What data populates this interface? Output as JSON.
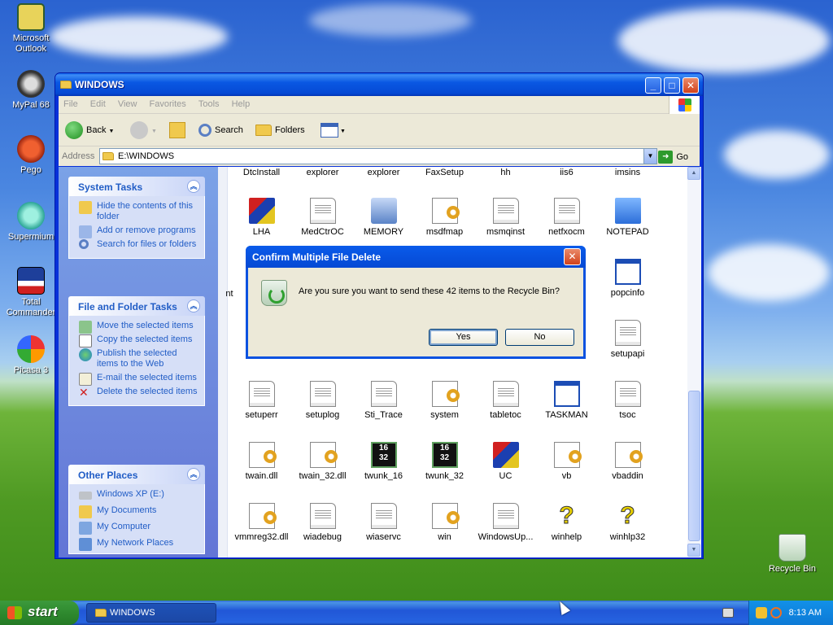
{
  "desktop": {
    "icons": [
      {
        "label": "Microsoft Outlook",
        "icon": "outlook-icon"
      },
      {
        "label": "MyPal 68",
        "icon": "mypal-icon"
      },
      {
        "label": "Pego",
        "icon": "pego-icon"
      },
      {
        "label": "Supermium",
        "icon": "supermium-icon"
      },
      {
        "label": "Total Commander",
        "icon": "total-commander-icon"
      },
      {
        "label": "Picasa 3",
        "icon": "picasa-icon"
      },
      {
        "label": "Recycle Bin",
        "icon": "recycle-bin-icon"
      }
    ]
  },
  "window": {
    "title": "WINDOWS",
    "menu": [
      "File",
      "Edit",
      "View",
      "Favorites",
      "Tools",
      "Help"
    ],
    "toolbar": {
      "back": "Back",
      "search": "Search",
      "folders": "Folders"
    },
    "address": {
      "label": "Address",
      "value": "E:\\WINDOWS",
      "go": "Go"
    }
  },
  "taskpane": {
    "system_tasks": {
      "title": "System Tasks",
      "items": [
        "Hide the contents of this folder",
        "Add or remove programs",
        "Search for files or folders"
      ]
    },
    "file_tasks": {
      "title": "File and Folder Tasks",
      "items": [
        "Move the selected items",
        "Copy the selected items",
        "Publish the selected items to the Web",
        "E-mail the selected items",
        "Delete the selected items"
      ]
    },
    "other_places": {
      "title": "Other Places",
      "items": [
        "Windows XP (E:)",
        "My Documents",
        "My Computer",
        "My Network Places"
      ]
    }
  },
  "files": {
    "top_row": [
      "DtcInstall",
      "explorer",
      "explorer",
      "FaxSetup",
      "hh",
      "iis6",
      "imsins"
    ],
    "row2": [
      "LHA",
      "MedCtrOC",
      "MEMORY",
      "msdfmap",
      "msmqinst",
      "netfxocm",
      "NOTEPAD"
    ],
    "row3_left": "nt",
    "row3_right": "popcinfo",
    "row4_right": "setupapi",
    "row5": [
      "setuperr",
      "setuplog",
      "Sti_Trace",
      "system",
      "tabletoc",
      "TASKMAN",
      "tsoc"
    ],
    "row6": [
      "twain.dll",
      "twain_32.dll",
      "twunk_16",
      "twunk_32",
      "UC",
      "vb",
      "vbaddin"
    ],
    "row7": [
      "vmmreg32.dll",
      "wiadebug",
      "wiaservc",
      "win",
      "WindowsUp...",
      "winhelp",
      "winhlp32"
    ],
    "icon_32_label": "32",
    "icon_16_label": "16"
  },
  "dialog": {
    "title": "Confirm Multiple File Delete",
    "message": "Are you sure you want to send these 42 items to the Recycle Bin?",
    "yes": "Yes",
    "no": "No"
  },
  "taskbar": {
    "start": "start",
    "task": "WINDOWS",
    "clock": "8:13 AM"
  }
}
